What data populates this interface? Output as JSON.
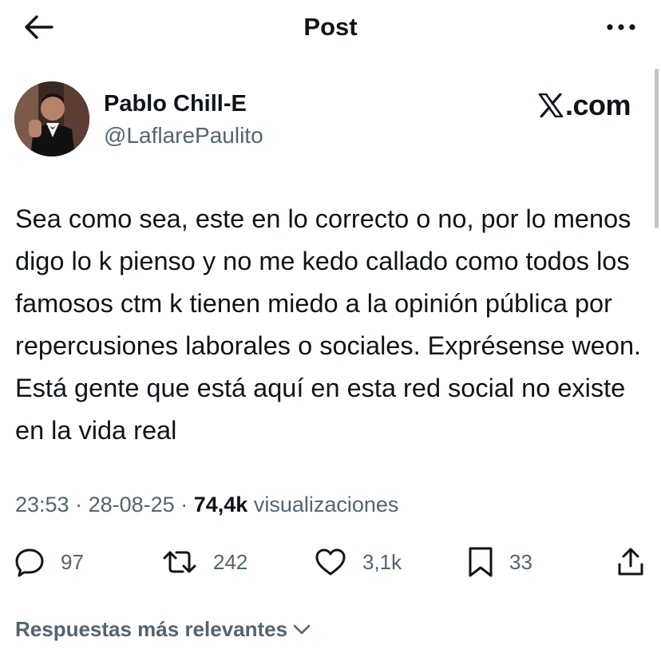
{
  "header": {
    "title": "Post",
    "back_icon": "arrow-left-icon",
    "more_icon": "more-horizontal-icon"
  },
  "author": {
    "name": "Pablo Chill-E",
    "handle": "@LaflarePaulito",
    "avatar_icon": "avatar-photo"
  },
  "brand": {
    "label": ".com",
    "logo_icon": "x-logo-icon"
  },
  "post": {
    "text": "Sea como sea, este en lo correcto o no, por lo menos digo lo k pienso y no me kedo callado como todos los famosos ctm k tienen miedo a la opinión pública por repercusiones laborales o sociales. Exprésense weon. Está gente que está aquí en esta red social no existe en la vida real"
  },
  "meta": {
    "time": "23:53",
    "separator": "·",
    "date": "28-08-25",
    "views_count": "74,4k",
    "views_label": "visualizaciones"
  },
  "actions": {
    "replies": "97",
    "reposts": "242",
    "likes": "3,1k",
    "bookmarks": "33",
    "reply_icon": "reply-bubble-icon",
    "repost_icon": "repost-icon",
    "like_icon": "heart-icon",
    "bookmark_icon": "bookmark-icon",
    "share_icon": "share-icon"
  },
  "replies_sort": {
    "label": "Respuestas más relevantes",
    "icon": "chevron-down-icon"
  },
  "colors": {
    "text": "#0f1419",
    "secondary": "#536471",
    "background": "#ffffff"
  }
}
